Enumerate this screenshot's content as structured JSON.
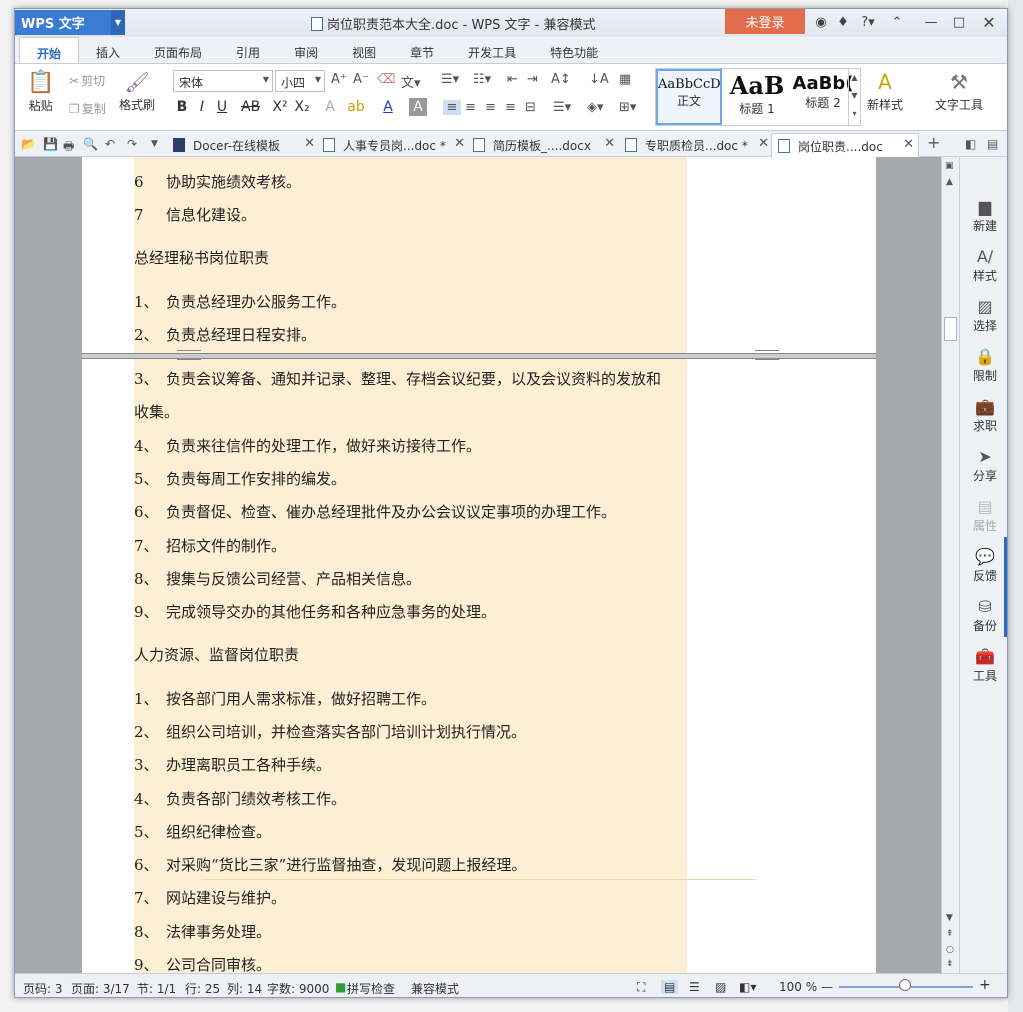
{
  "app": {
    "logo": "WPS 文字",
    "title": "岗位职责范本大全.doc - WPS 文字 - 兼容模式",
    "login": "未登录"
  },
  "ribbon_tabs": [
    "开始",
    "插入",
    "页面布局",
    "引用",
    "审阅",
    "视图",
    "章节",
    "开发工具",
    "特色功能"
  ],
  "ribbon": {
    "paste": "粘贴",
    "cut": "剪切",
    "copy": "复制",
    "format_painter": "格式刷",
    "font_name": "宋体",
    "font_size": "小四",
    "styles": [
      {
        "preview": "AaBbCcD",
        "label": "正文"
      },
      {
        "preview": "AaB",
        "label": "标题 1"
      },
      {
        "preview": "AaBb(",
        "label": "标题 2"
      }
    ],
    "new_style": "新样式",
    "text_tools": "文字工具"
  },
  "doc_tabs": [
    "Docer-在线模板",
    "人事专员岗...doc *",
    "简历模板_....docx",
    "专职质检员...doc *",
    "岗位职责....doc"
  ],
  "doc": {
    "page1": [
      {
        "n": "6",
        "t": "协助实施绩效考核。"
      },
      {
        "n": "7",
        "t": "信息化建设。"
      },
      {
        "n": "",
        "t": "总经理秘书岗位职责"
      },
      {
        "n": "1、",
        "t": "负责总经理办公服务工作。"
      },
      {
        "n": "2、",
        "t": "负责总经理日程安排。"
      }
    ],
    "page2": [
      {
        "n": "3、",
        "t": "负责会议筹备、通知并记录、整理、存档会议纪要，以及会议资料的发放和"
      },
      {
        "n": "",
        "t": "收集。"
      },
      {
        "n": "4、",
        "t": "负责来往信件的处理工作，做好来访接待工作。"
      },
      {
        "n": "5、",
        "t": "负责每周工作安排的编发。"
      },
      {
        "n": "6、",
        "t": "负责督促、检查、催办总经理批件及办公会议议定事项的办理工作。"
      },
      {
        "n": "7、",
        "t": "招标文件的制作。"
      },
      {
        "n": "8、",
        "t": "搜集与反馈公司经营、产品相关信息。"
      },
      {
        "n": "9、",
        "t": "完成领导交办的其他任务和各种应急事务的处理。"
      },
      {
        "n": "",
        "t": "人力资源、监督岗位职责"
      },
      {
        "n": "1、",
        "t": "按各部门用人需求标准，做好招聘工作。"
      },
      {
        "n": "2、",
        "t": "组织公司培训，并检查落实各部门培训计划执行情况。"
      },
      {
        "n": "3、",
        "t": "办理离职员工各种手续。"
      },
      {
        "n": "4、",
        "t": "负责各部门绩效考核工作。"
      },
      {
        "n": "5、",
        "t": "组织纪律检查。"
      },
      {
        "n": "6、",
        "t": "对采购“货比三家”进行监督抽查，发现问题上报经理。"
      },
      {
        "n": "7、",
        "t": "网站建设与维护。"
      },
      {
        "n": "8、",
        "t": "法律事务处理。"
      },
      {
        "n": "9、",
        "t": "公司合同审核。"
      }
    ]
  },
  "side_panel": [
    "新建",
    "样式",
    "选择",
    "限制",
    "求职",
    "分享",
    "属性",
    "反馈",
    "备份",
    "工具"
  ],
  "status": {
    "page_code": "页码: 3",
    "pages": "页面: 3/17",
    "section": "节: 1/1",
    "row": "行: 25",
    "col": "列: 14",
    "words": "字数: 9000",
    "spell": "拼写检查",
    "mode": "兼容模式",
    "zoom": "100 %"
  },
  "colors": {
    "accent": "#3a7bd5",
    "login_bg": "#e46c4c",
    "highlight": "#fdefd3"
  }
}
